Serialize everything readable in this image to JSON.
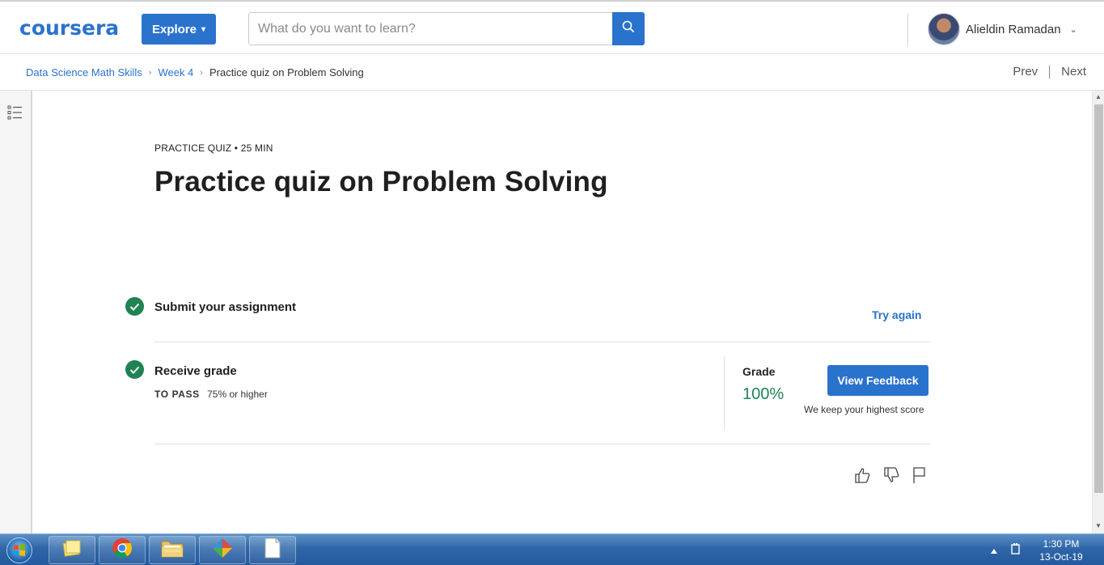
{
  "header": {
    "logo": "coursera",
    "explore_label": "Explore",
    "search_placeholder": "What do you want to learn?",
    "user_name": "Alieldin Ramadan"
  },
  "breadcrumb": {
    "items": [
      "Data Science Math Skills",
      "Week 4"
    ],
    "current": "Practice quiz on Problem Solving",
    "prev": "Prev",
    "next": "Next"
  },
  "main": {
    "kicker": "PRACTICE QUIZ • 25 MIN",
    "title": "Practice quiz on Problem Solving",
    "submit_title": "Submit your assignment",
    "try_again": "Try again",
    "receive_title": "Receive grade",
    "to_pass_label": "TO PASS",
    "to_pass_value": "75% or higher",
    "grade_label": "Grade",
    "grade_value": "100%",
    "view_feedback": "View Feedback",
    "keep_note": "We keep your highest score"
  },
  "taskbar": {
    "time": "1:30 PM",
    "date": "13-Oct-19"
  },
  "colors": {
    "brand": "#2a73cc",
    "success": "#1f8354"
  },
  "icons": [
    "search-icon",
    "menu-list-icon",
    "check-icon",
    "thumbs-up-icon",
    "thumbs-down-icon",
    "flag-icon",
    "windows-start-icon"
  ]
}
